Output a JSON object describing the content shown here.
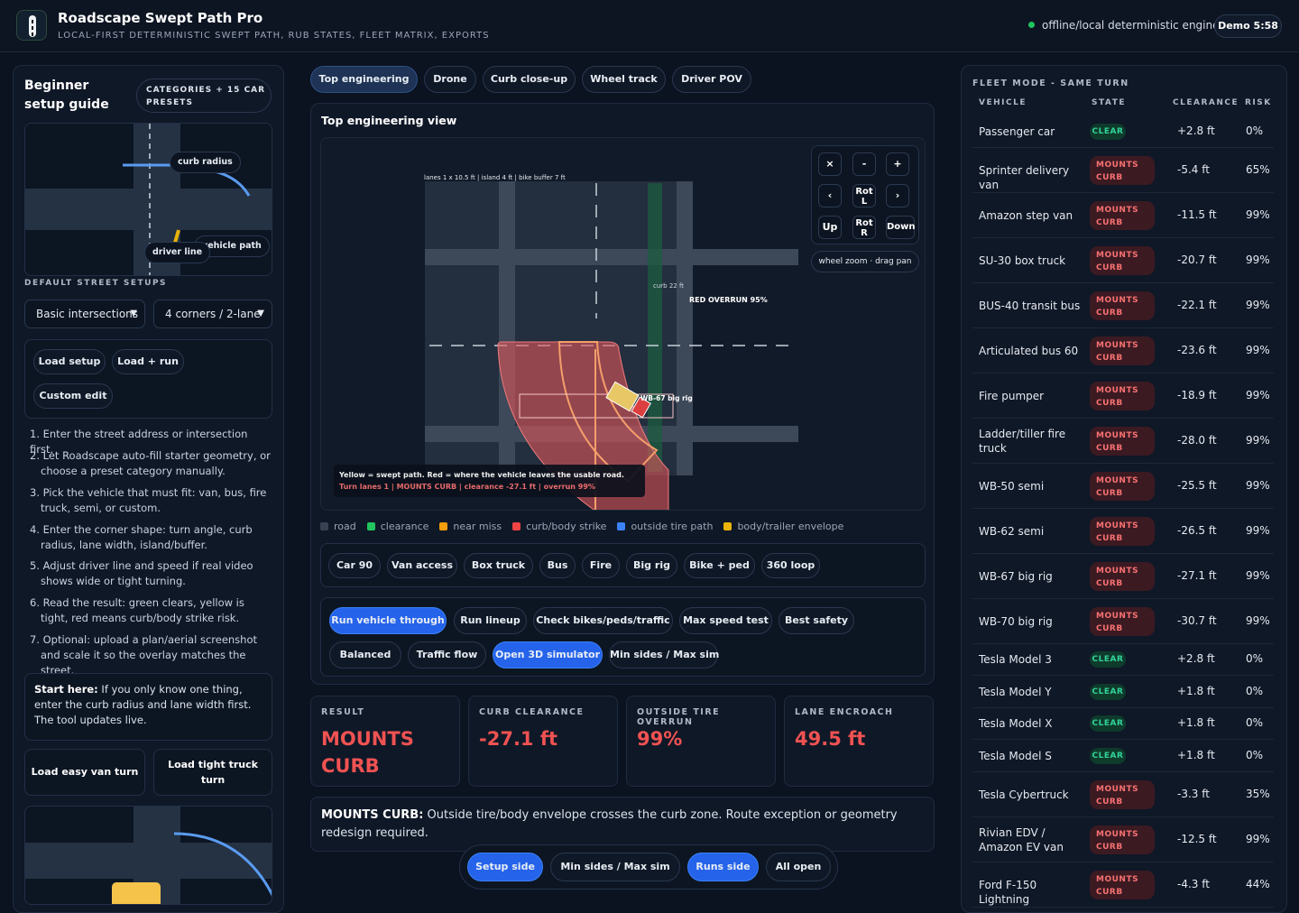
{
  "app": {
    "title": "Roadscape Swept Path Pro",
    "subtitle": "LOCAL-FIRST DETERMINISTIC SWEPT PATH, RUB STATES, FLEET MATRIX, EXPORTS",
    "engine_status": "offline/local deterministic engine",
    "demo_label": "Demo 5:58"
  },
  "left": {
    "guide_title": "Beginner setup guide",
    "presets_badge": "CATEGORIES + 15 CAR PRESETS",
    "mini_labels": {
      "curb_radius": "curb radius",
      "vehicle_path": "vehicle path",
      "driver_line": "driver line"
    },
    "default_setups_label": "DEFAULT STREET SETUPS",
    "select_category": "Basic intersections",
    "select_layout": "4 corners / 2-lane",
    "buttons": {
      "load_setup": "Load setup",
      "load_run": "Load + run",
      "custom_edit": "Custom edit"
    },
    "steps": [
      "1. Enter the street address or intersection first.",
      "2. Let Roadscape auto-fill starter geometry, or choose a preset category manually.",
      "3. Pick the vehicle that must fit: van, bus, fire truck, semi, or custom.",
      "4. Enter the corner shape: turn angle, curb radius, lane width, island/buffer.",
      "5. Adjust driver line and speed if real video shows wide or tight turning.",
      "6. Read the result: green clears, yellow is tight, red means curb/body strike risk.",
      "7. Optional: upload a plan/aerial screenshot and scale it so the overlay matches the street."
    ],
    "start_here_bold": "Start here:",
    "start_here_text": " If you only know one thing, enter the curb radius and lane width first. The tool updates live.",
    "load_easy": "Load easy van turn",
    "load_tight": "Load tight truck turn"
  },
  "center": {
    "view_tabs": [
      "Top engineering",
      "Drone",
      "Curb close-up",
      "Wheel track",
      "Driver POV"
    ],
    "view_title": "Top engineering view",
    "map": {
      "dims_label": "lanes 1 x 10.5 ft | island 4 ft | bike buffer 7 ft",
      "curb_label": "curb 22 ft",
      "overrun_label": "RED OVERRUN 95%",
      "vehicle_label": "WB-67 big rig",
      "note_line1": "Yellow = swept path. Red = where the vehicle leaves the usable road.",
      "note_line2": "Turn lanes 1 | MOUNTS CURB | clearance -27.1 ft | overrun 99%",
      "controls": {
        "close": "×",
        "minus": "-",
        "plus": "+",
        "left": "‹",
        "rot_l": "Rot L",
        "right": "›",
        "up": "Up",
        "rot_r": "Rot R",
        "down": "Down",
        "hint": "wheel zoom · drag pan"
      }
    },
    "legend": [
      {
        "label": "road",
        "color": "#374151"
      },
      {
        "label": "clearance",
        "color": "#22c55e"
      },
      {
        "label": "near miss",
        "color": "#f59e0b"
      },
      {
        "label": "curb/body strike",
        "color": "#ef4444"
      },
      {
        "label": "outside tire path",
        "color": "#3b82f6"
      },
      {
        "label": "body/trailer envelope",
        "color": "#eab308"
      }
    ],
    "vehicle_presets": [
      "Car 90",
      "Van access",
      "Box truck",
      "Bus",
      "Fire",
      "Big rig",
      "Bike + ped",
      "360 loop"
    ],
    "actions_row1": [
      "Run vehicle through",
      "Run lineup",
      "Check bikes/peds/traffic",
      "Max speed test",
      "Best safety"
    ],
    "actions_row2": [
      "Balanced",
      "Traffic flow",
      "Open 3D simulator",
      "Min sides / Max sim"
    ],
    "stats": [
      {
        "key": "RESULT",
        "value": "MOUNTS CURB"
      },
      {
        "key": "CURB CLEARANCE",
        "value": "-27.1 ft"
      },
      {
        "key": "OUTSIDE TIRE OVERRUN",
        "value": "99%"
      },
      {
        "key": "LANE ENCROACH",
        "value": "49.5 ft"
      }
    ],
    "message_bold": "MOUNTS CURB:",
    "message_text": " Outside tire/body envelope crosses the curb zone. Route exception or geometry redesign required.",
    "bottom_tabs": [
      "Setup side",
      "Min sides / Max sim",
      "Runs side",
      "All open"
    ]
  },
  "fleet": {
    "title": "FLEET MODE - SAME TURN",
    "headers": [
      "VEHICLE",
      "STATE",
      "CLEARANCE",
      "RISK"
    ],
    "rows": [
      {
        "vehicle": "Passenger car",
        "state": "CLEAR",
        "clearance": "+2.8 ft",
        "risk": "0%"
      },
      {
        "vehicle": "Sprinter delivery van",
        "state": "MOUNTS CURB",
        "clearance": "-5.4 ft",
        "risk": "65%"
      },
      {
        "vehicle": "Amazon step van",
        "state": "MOUNTS CURB",
        "clearance": "-11.5 ft",
        "risk": "99%"
      },
      {
        "vehicle": "SU-30 box truck",
        "state": "MOUNTS CURB",
        "clearance": "-20.7 ft",
        "risk": "99%"
      },
      {
        "vehicle": "BUS-40 transit bus",
        "state": "MOUNTS CURB",
        "clearance": "-22.1 ft",
        "risk": "99%"
      },
      {
        "vehicle": "Articulated bus 60",
        "state": "MOUNTS CURB",
        "clearance": "-23.6 ft",
        "risk": "99%"
      },
      {
        "vehicle": "Fire pumper",
        "state": "MOUNTS CURB",
        "clearance": "-18.9 ft",
        "risk": "99%"
      },
      {
        "vehicle": "Ladder/tiller fire truck",
        "state": "MOUNTS CURB",
        "clearance": "-28.0 ft",
        "risk": "99%"
      },
      {
        "vehicle": "WB-50 semi",
        "state": "MOUNTS CURB",
        "clearance": "-25.5 ft",
        "risk": "99%"
      },
      {
        "vehicle": "WB-62 semi",
        "state": "MOUNTS CURB",
        "clearance": "-26.5 ft",
        "risk": "99%"
      },
      {
        "vehicle": "WB-67 big rig",
        "state": "MOUNTS CURB",
        "clearance": "-27.1 ft",
        "risk": "99%"
      },
      {
        "vehicle": "WB-70 big rig",
        "state": "MOUNTS CURB",
        "clearance": "-30.7 ft",
        "risk": "99%"
      },
      {
        "vehicle": "Tesla Model 3",
        "state": "CLEAR",
        "clearance": "+2.8 ft",
        "risk": "0%"
      },
      {
        "vehicle": "Tesla Model Y",
        "state": "CLEAR",
        "clearance": "+1.8 ft",
        "risk": "0%"
      },
      {
        "vehicle": "Tesla Model X",
        "state": "CLEAR",
        "clearance": "+1.8 ft",
        "risk": "0%"
      },
      {
        "vehicle": "Tesla Model S",
        "state": "CLEAR",
        "clearance": "+1.8 ft",
        "risk": "0%"
      },
      {
        "vehicle": "Tesla Cybertruck",
        "state": "MOUNTS CURB",
        "clearance": "-3.3 ft",
        "risk": "35%"
      },
      {
        "vehicle": "Rivian EDV / Amazon EV van",
        "state": "MOUNTS CURB",
        "clearance": "-12.5 ft",
        "risk": "99%"
      },
      {
        "vehicle": "Ford F-150 Lightning",
        "state": "MOUNTS CURB",
        "clearance": "-4.3 ft",
        "risk": "44%"
      }
    ]
  }
}
